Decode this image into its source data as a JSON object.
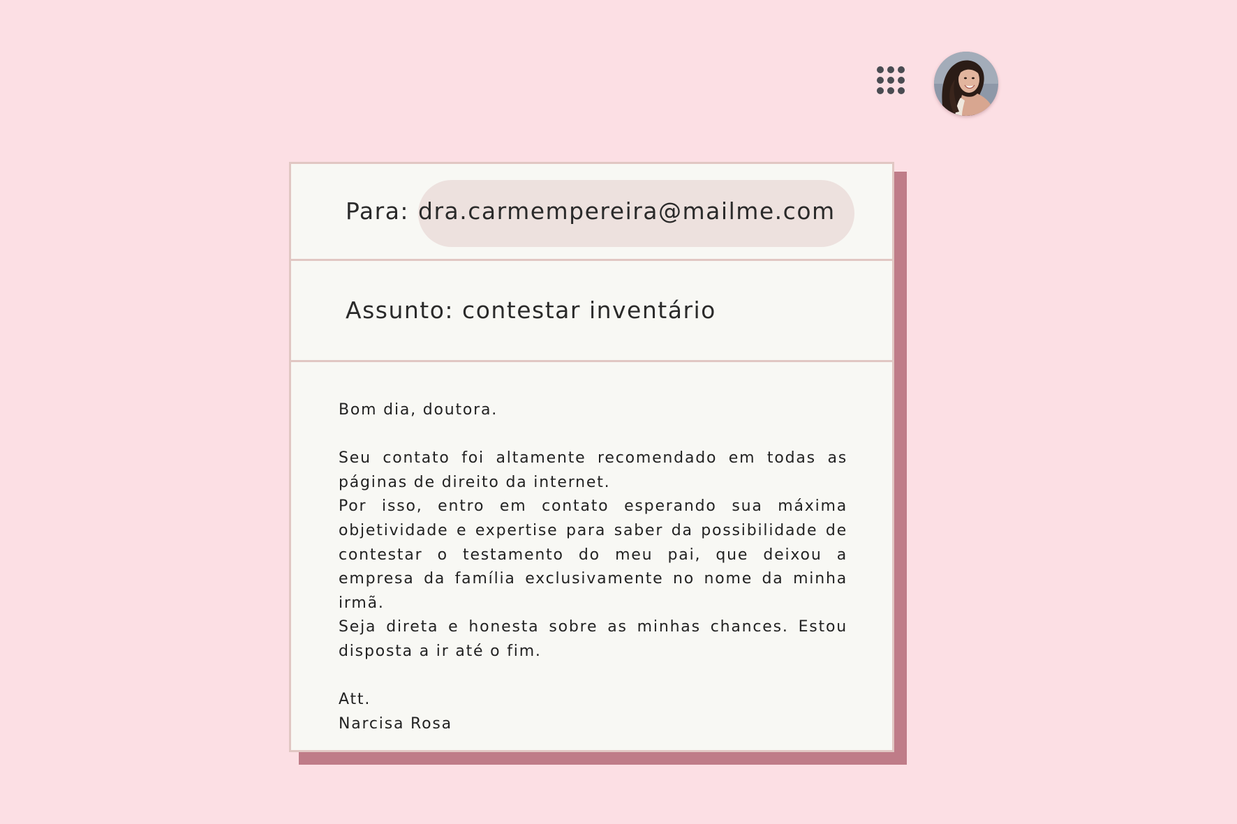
{
  "header": {
    "apps_icon": "grid-apps-icon",
    "avatar": "user-avatar"
  },
  "email": {
    "to_label": "Para:",
    "to_value": "dra.carmempereira@mailme.com",
    "subject_label": "Assunto:",
    "subject_value": "contestar inventário",
    "greeting": "Bom dia, doutora.",
    "paragraphs": [
      "Seu contato foi altamente recomendado em todas as páginas de direito da internet.",
      "Por isso, entro em contato esperando sua máxima objetividade e expertise para saber da possibilidade de contestar o testamento do meu pai, que deixou a empresa da família exclusivamente no nome da minha irmã.",
      "Seja direta e honesta sobre as minhas chances. Estou disposta a ir até o fim."
    ],
    "closing": "Att.",
    "signature": "Narcisa Rosa"
  },
  "colors": {
    "background": "#fcdfe4",
    "card": "#f8f8f4",
    "card_border": "#e1c7c3",
    "card_shadow": "#bf7c88",
    "chip": "#ede1de",
    "icon": "#4a4c52"
  }
}
